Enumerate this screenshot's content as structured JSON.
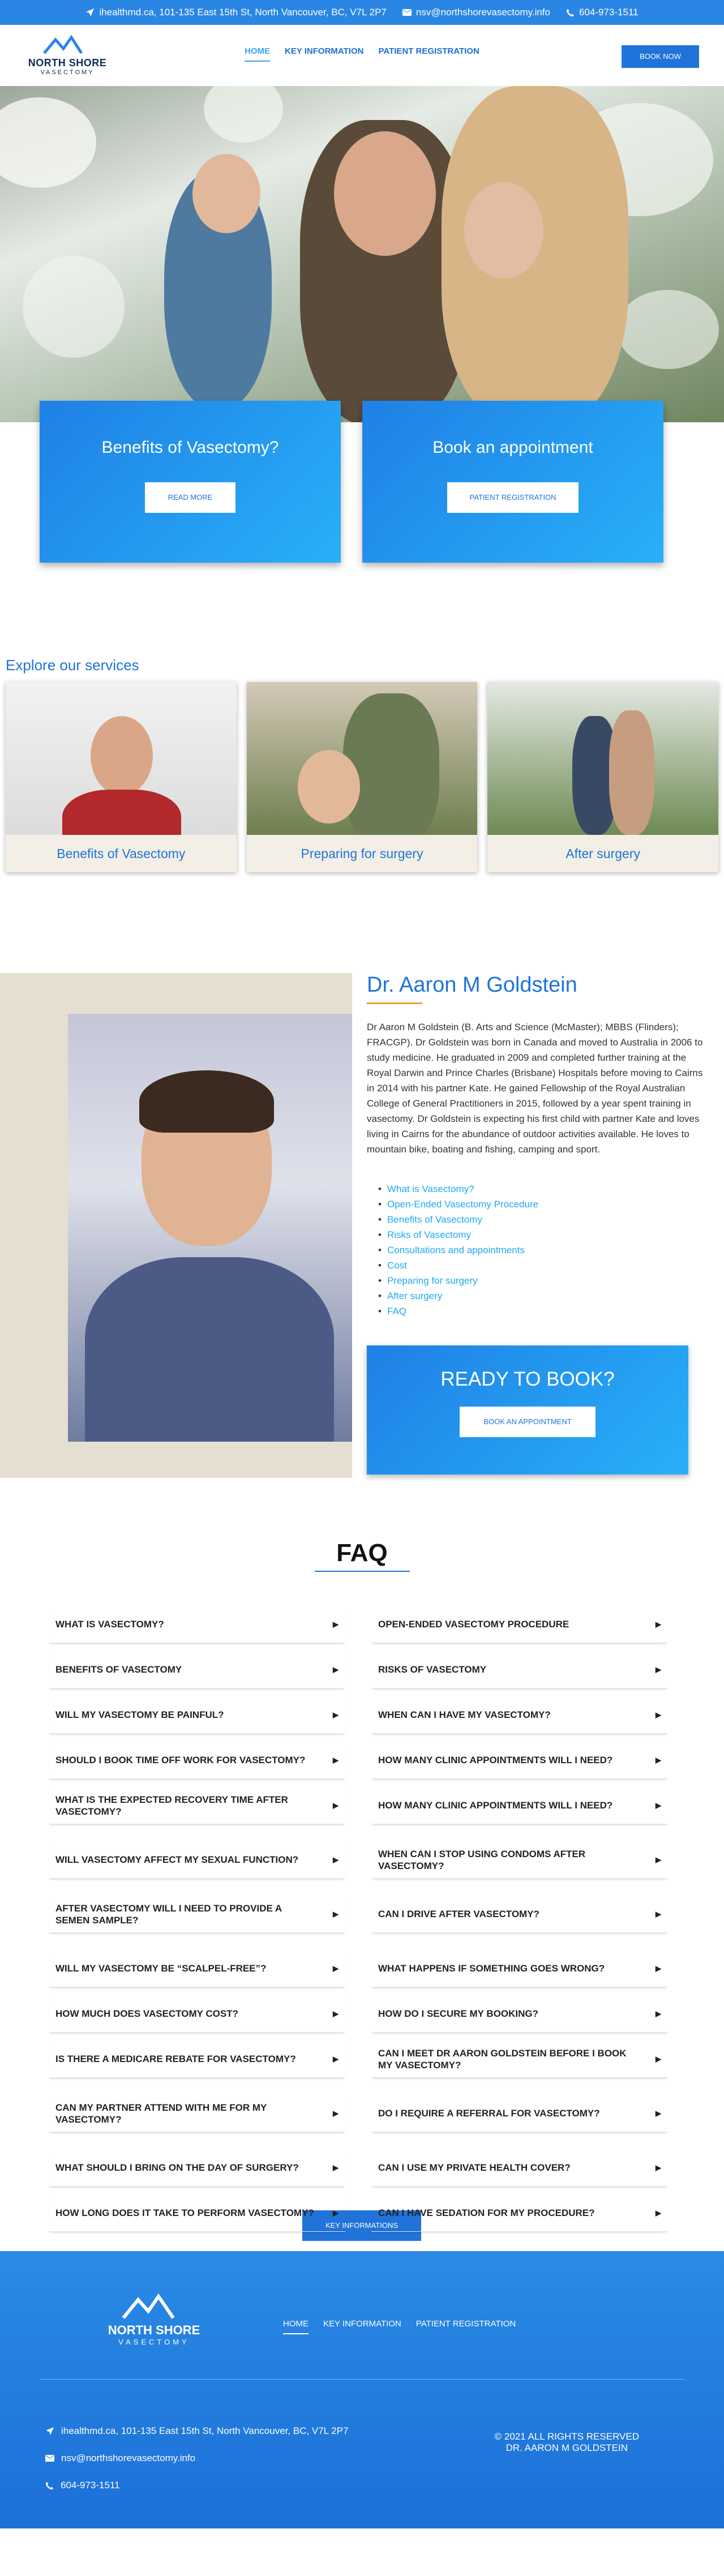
{
  "topbar": {
    "address": "ihealthmd.ca, 101-135 East 15th St, North Vancouver, BC, V7L 2P7",
    "email": "nsv@northshorevasectomy.info",
    "phone": "604-973-1511"
  },
  "logo": {
    "line1": "NORTH SHORE",
    "line2": "VASECTOMY"
  },
  "nav": {
    "items": [
      "HOME",
      "KEY INFORMATION",
      "PATIENT REGISTRATION"
    ],
    "cta": "BOOK NOW"
  },
  "cards": [
    {
      "title": "Benefits of Vasectomy?",
      "button": "READ MORE"
    },
    {
      "title": "Book an appointment",
      "button": "PATIENT REGISTRATION"
    }
  ],
  "services": {
    "heading": "Explore our services",
    "items": [
      "Benefits of Vasectomy",
      "Preparing for surgery",
      "After surgery"
    ]
  },
  "doctor": {
    "name": "Dr. Aaron M Goldstein",
    "bio": "Dr Aaron M Goldstein (B. Arts and Science (McMaster); MBBS (Flinders); FRACGP). Dr Goldstein was born in Canada and moved to Australia in 2006 to study medicine. He graduated in 2009 and completed further training at the Royal Darwin and Prince Charles (Brisbane) Hospitals before moving to Cairns in 2014 with his partner Kate. He gained Fellowship of the Royal Australian College of General Practitioners in 2015, followed by a year spent training in vasectomy. Dr Goldstein is expecting his first child with partner Kate and loves living in Cairns for the abundance of outdoor activities available. He loves to mountain bike, boating and fishing, camping and sport.",
    "links": [
      "What is Vasectomy?",
      "Open-Ended Vasectomy Procedure",
      "Benefits of Vasectomy",
      "Risks of Vasectomy",
      "Consultations and appointments",
      "Cost",
      "Preparing for surgery",
      "After surgery",
      "FAQ"
    ]
  },
  "ready": {
    "title": "READY TO BOOK?",
    "button": "BOOK AN APPOINTMENT"
  },
  "faq": {
    "title": "FAQ",
    "left": [
      "WHAT IS VASECTOMY?",
      "BENEFITS OF VASECTOMY",
      "WILL MY VASECTOMY BE PAINFUL?",
      "SHOULD I BOOK TIME OFF WORK FOR VASECTOMY?",
      "WHAT IS THE EXPECTED RECOVERY TIME AFTER VASECTOMY?",
      "WILL VASECTOMY AFFECT MY SEXUAL FUNCTION?",
      "AFTER VASECTOMY WILL I NEED TO PROVIDE A SEMEN SAMPLE?",
      "WILL MY VASECTOMY BE “SCALPEL-FREE”?",
      "HOW MUCH DOES VASECTOMY COST?",
      "IS THERE A MEDICARE REBATE FOR VASECTOMY?",
      "CAN MY PARTNER ATTEND WITH ME FOR MY VASECTOMY?",
      "WHAT SHOULD I BRING ON THE DAY OF SURGERY?",
      "HOW LONG DOES IT TAKE TO PERFORM VASECTOMY?"
    ],
    "right": [
      "OPEN-ENDED VASECTOMY PROCEDURE",
      "RISKS OF VASECTOMY",
      "WHEN CAN I HAVE MY VASECTOMY?",
      "HOW MANY CLINIC APPOINTMENTS WILL I NEED?",
      "HOW MANY CLINIC APPOINTMENTS WILL I NEED?",
      "WHEN CAN I STOP USING CONDOMS AFTER VASECTOMY?",
      "CAN I DRIVE AFTER VASECTOMY?",
      "WHAT HAPPENS IF SOMETHING GOES WRONG?",
      "HOW DO I SECURE MY BOOKING?",
      "CAN I MEET DR AARON GOLDSTEIN BEFORE I BOOK MY VASECTOMY?",
      "DO I REQUIRE A REFERRAL FOR VASECTOMY?",
      "CAN I USE MY PRIVATE HEALTH COVER?",
      "CAN I HAVE SEDATION FOR MY PROCEDURE?"
    ],
    "button": "KEY INFORMATIONS"
  },
  "footer": {
    "copyright1": "© 2021 ALL RIGHTS RESERVED",
    "copyright2": "DR. AARON M GOLDSTEIN"
  },
  "colors": {
    "brand": "#1f73d9",
    "accent": "#28b0f8",
    "topbar": "#2a86e4"
  }
}
